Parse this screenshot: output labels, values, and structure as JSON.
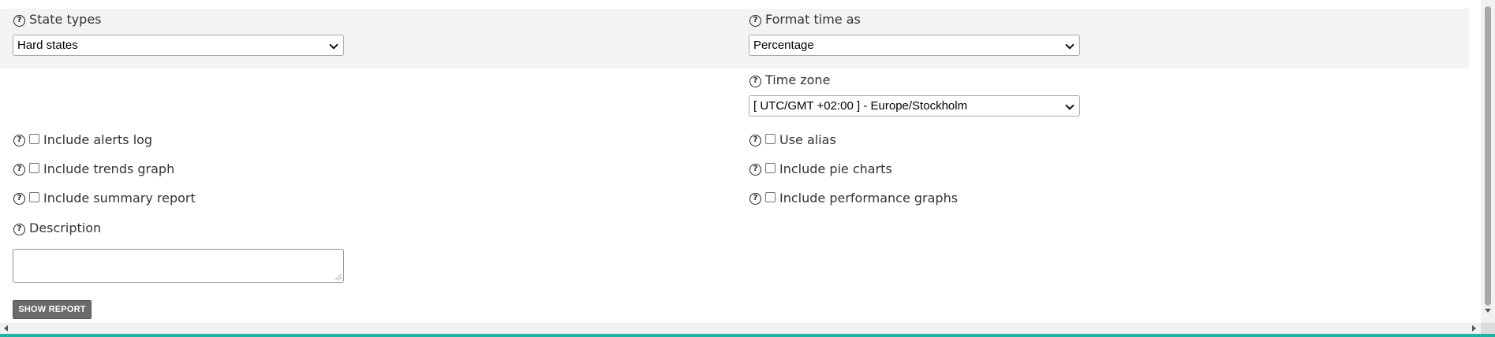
{
  "form": {
    "state_types": {
      "label": "State types",
      "selected": "Hard states"
    },
    "format_time": {
      "label": "Format time as",
      "selected": "Percentage"
    },
    "time_zone": {
      "label": "Time zone",
      "selected": "[ UTC/GMT +02:00 ] - Europe/Stockholm"
    },
    "checkboxes_left": [
      {
        "label": "Include alerts log",
        "checked": false
      },
      {
        "label": "Include trends graph",
        "checked": false
      },
      {
        "label": "Include summary report",
        "checked": false
      }
    ],
    "checkboxes_right": [
      {
        "label": "Use alias",
        "checked": false
      },
      {
        "label": "Include pie charts",
        "checked": false
      },
      {
        "label": "Include performance graphs",
        "checked": false
      }
    ],
    "description": {
      "label": "Description",
      "value": ""
    },
    "submit_label": "SHOW REPORT"
  },
  "icons": {
    "help": "help-icon",
    "dropdown": "chevron-down-icon",
    "scroll_left": "arrow-left-icon",
    "scroll_right": "arrow-right-icon",
    "scroll_down": "arrow-down-icon"
  },
  "colors": {
    "shaded_row": "#f3f3f3",
    "button_bg": "#6b6b6b",
    "bottom_accent": "#1fb3a5"
  }
}
